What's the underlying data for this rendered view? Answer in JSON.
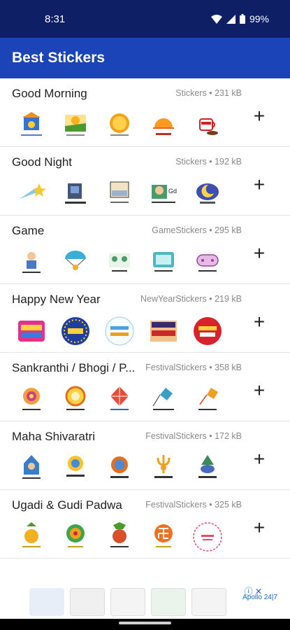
{
  "status": {
    "time": "8:31",
    "battery": "99%"
  },
  "app_title": "Best Stickers",
  "packs": [
    {
      "title": "Good Morning",
      "meta": "Stickers • 231 kB"
    },
    {
      "title": "Good Night",
      "meta": "Stickers • 192 kB"
    },
    {
      "title": "Game",
      "meta": "GameStickers • 295 kB"
    },
    {
      "title": "Happy New Year",
      "meta": "NewYearStickers • 219 kB"
    },
    {
      "title": "Sankranthi / Bhogi / P...",
      "meta": "FestivalStickers • 358 kB"
    },
    {
      "title": "Maha Shivaratri",
      "meta": "FestivalStickers • 172 kB"
    },
    {
      "title": "Ugadi & Gudi Padwa",
      "meta": "FestivalStickers • 325 kB"
    }
  ],
  "add_symbol": "+",
  "ad": {
    "label": "Apollo 24|7"
  },
  "colors": {
    "status_bg": "#0e1f66",
    "appbar_bg": "#1a44b8"
  }
}
